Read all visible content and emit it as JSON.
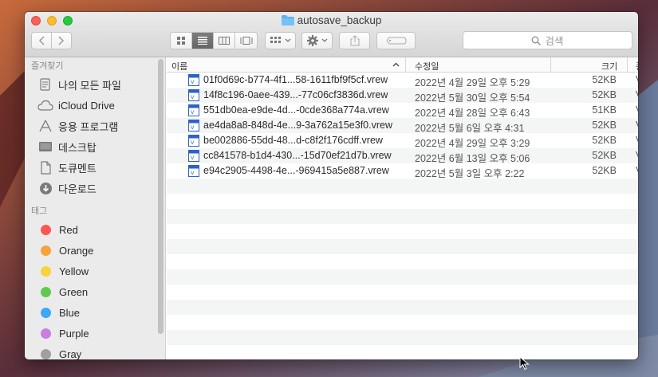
{
  "window": {
    "title": "autosave_backup"
  },
  "toolbar": {
    "search_placeholder": "검색"
  },
  "sidebar": {
    "favorites_header": "즐겨찾기",
    "favorites": [
      {
        "label": "나의 모든 파일",
        "icon": "all-files-icon"
      },
      {
        "label": "iCloud Drive",
        "icon": "cloud-icon"
      },
      {
        "label": "응용 프로그램",
        "icon": "applications-icon"
      },
      {
        "label": "데스크탑",
        "icon": "desktop-icon"
      },
      {
        "label": "도큐멘트",
        "icon": "documents-icon"
      },
      {
        "label": "다운로드",
        "icon": "downloads-icon"
      }
    ],
    "tags_header": "태그",
    "tags": [
      {
        "label": "Red",
        "color": "#fc5753"
      },
      {
        "label": "Orange",
        "color": "#f5a33d"
      },
      {
        "label": "Yellow",
        "color": "#f7d33c"
      },
      {
        "label": "Green",
        "color": "#62c94e"
      },
      {
        "label": "Blue",
        "color": "#3fa7f7"
      },
      {
        "label": "Purple",
        "color": "#c97ee0"
      },
      {
        "label": "Gray",
        "color": "#a0a0a0"
      }
    ]
  },
  "columns": {
    "name": "이름",
    "modified": "수정일",
    "size": "크기",
    "kind": "종"
  },
  "files": [
    {
      "name": "01f0d69c-b774-4f1...58-1611fbf9f5cf.vrew",
      "modified": "2022년 4월 29일 오후 5:29",
      "size": "52KB",
      "kind": "V"
    },
    {
      "name": "14f8c196-0aee-439...-77c06cf3836d.vrew",
      "modified": "2022년 5월 30일 오후 5:54",
      "size": "52KB",
      "kind": "V"
    },
    {
      "name": "551db0ea-e9de-4d...-0cde368a774a.vrew",
      "modified": "2022년 4월 28일 오후 6:43",
      "size": "51KB",
      "kind": "V"
    },
    {
      "name": "ae4da8a8-848d-4e...9-3a762a15e3f0.vrew",
      "modified": "2022년 5월 6일 오후 4:31",
      "size": "52KB",
      "kind": "V"
    },
    {
      "name": "be002886-55dd-48...d-c8f2f176cdff.vrew",
      "modified": "2022년 4월 29일 오후 3:29",
      "size": "52KB",
      "kind": "V"
    },
    {
      "name": "cc841578-b1d4-430...-15d70ef21d7b.vrew",
      "modified": "2022년 6월 13일 오후 5:06",
      "size": "52KB",
      "kind": "V"
    },
    {
      "name": "e94c2905-4498-4e...-969415a5e887.vrew",
      "modified": "2022년 5월 3일 오후 2:22",
      "size": "52KB",
      "kind": "V"
    }
  ]
}
